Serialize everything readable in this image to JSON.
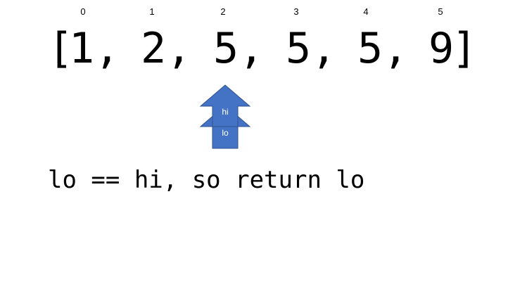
{
  "indices": [
    "0",
    "1",
    "2",
    "3",
    "4",
    "5"
  ],
  "array": {
    "open_bracket": "[",
    "values": [
      "1,",
      "2,",
      "5,",
      "5,",
      "5,",
      "9"
    ],
    "close_bracket": "]"
  },
  "pointers": {
    "hi": "hi",
    "lo": "lo",
    "color": "#4472C4",
    "border_color": "#2F528F"
  },
  "statement": "lo == hi, so return lo"
}
